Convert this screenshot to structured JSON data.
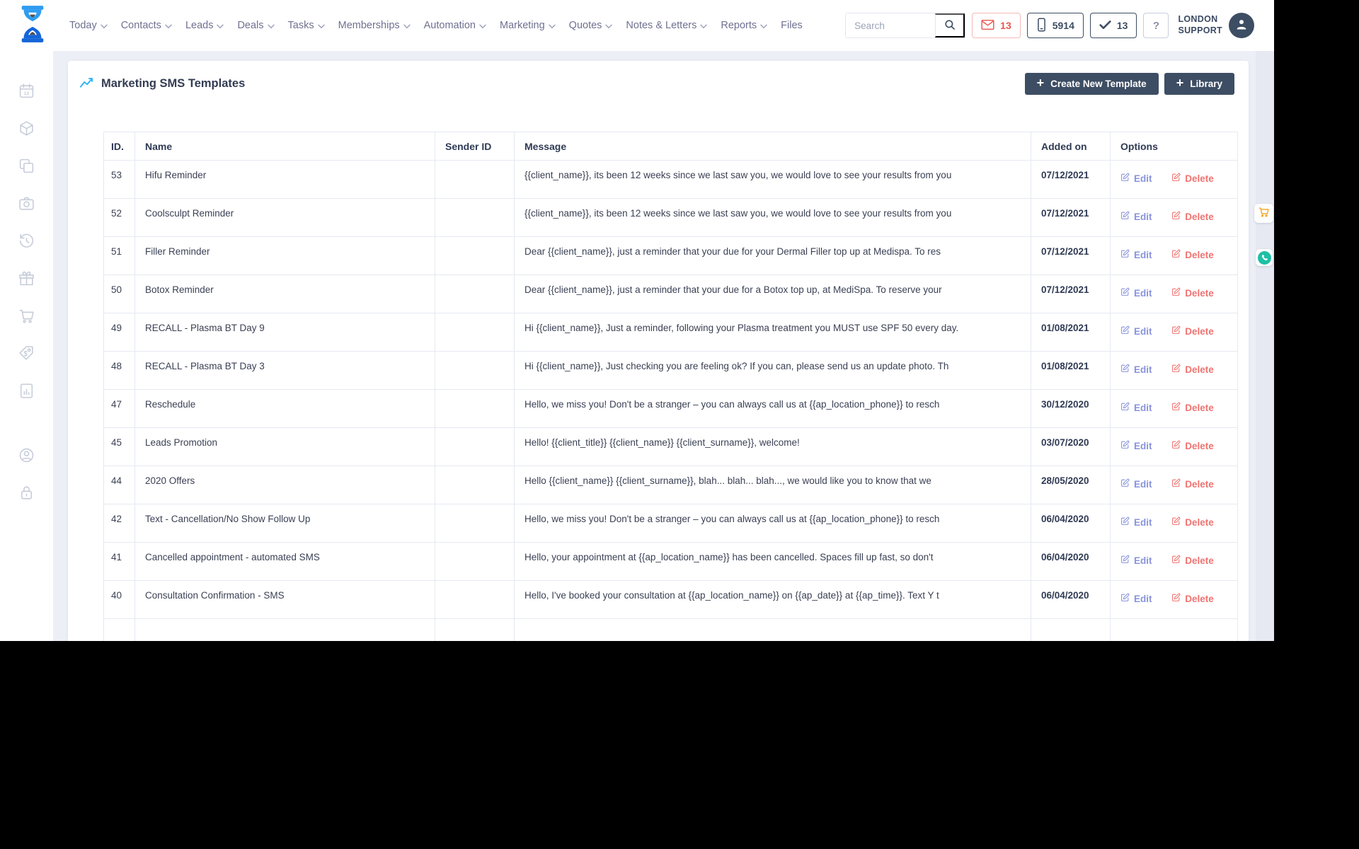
{
  "nav": {
    "items": [
      {
        "label": "Today",
        "dropdown": true
      },
      {
        "label": "Contacts",
        "dropdown": true
      },
      {
        "label": "Leads",
        "dropdown": true
      },
      {
        "label": "Deals",
        "dropdown": true
      },
      {
        "label": "Tasks",
        "dropdown": true
      },
      {
        "label": "Memberships",
        "dropdown": true
      },
      {
        "label": "Automation",
        "dropdown": true
      },
      {
        "label": "Marketing",
        "dropdown": true
      },
      {
        "label": "Quotes",
        "dropdown": true
      },
      {
        "label": "Notes & Letters",
        "dropdown": true
      },
      {
        "label": "Reports",
        "dropdown": true
      },
      {
        "label": "Files",
        "dropdown": false
      }
    ],
    "search_placeholder": "Search",
    "badges": {
      "mail_count": "13",
      "sms_count": "5914",
      "tasks_count": "13"
    },
    "help_label": "?",
    "account_line1": "LONDON",
    "account_line2": "SUPPORT"
  },
  "sidebar": {
    "icons": [
      "calendar",
      "package",
      "copy",
      "camera",
      "history",
      "gift",
      "cart",
      "price-tag",
      "report",
      "account",
      "lock"
    ]
  },
  "page": {
    "title": "Marketing SMS Templates",
    "plus": "+",
    "create_button": "Create New Template",
    "library_button": "Library"
  },
  "table": {
    "columns": [
      "ID.",
      "Name",
      "Sender ID",
      "Message",
      "Added on",
      "Options"
    ],
    "edit_label": "Edit",
    "delete_label": "Delete",
    "rows": [
      {
        "id": "53",
        "name": "Hifu Reminder",
        "sender_id": "",
        "message": "{{client_name}}, its been 12 weeks since we last saw you, we would love to see your results from you",
        "added_on": "07/12/2021"
      },
      {
        "id": "52",
        "name": "Coolsculpt Reminder",
        "sender_id": "",
        "message": "{{client_name}}, its been 12 weeks since we last saw you, we would love to see your results from you",
        "added_on": "07/12/2021"
      },
      {
        "id": "51",
        "name": "Filler Reminder",
        "sender_id": "",
        "message": "Dear {{client_name}}, just a reminder that your due for your Dermal Filler top up at Medispa. To res",
        "added_on": "07/12/2021"
      },
      {
        "id": "50",
        "name": "Botox Reminder",
        "sender_id": "",
        "message": "Dear {{client_name}}, just a reminder that your due for a Botox top up, at MediSpa. To reserve your",
        "added_on": "07/12/2021"
      },
      {
        "id": "49",
        "name": "RECALL - Plasma BT Day 9",
        "sender_id": "",
        "message": "Hi {{client_name}}, Just a reminder, following your Plasma treatment you MUST use SPF 50 every day.",
        "added_on": "01/08/2021"
      },
      {
        "id": "48",
        "name": "RECALL - Plasma BT Day 3",
        "sender_id": "",
        "message": "Hi {{client_name}}, Just checking you are feeling ok? If you can, please send us an update photo. Th",
        "added_on": "01/08/2021"
      },
      {
        "id": "47",
        "name": "Reschedule",
        "sender_id": "",
        "message": "Hello, we miss you! Don't be a stranger – you can always call us at {{ap_location_phone}} to resch",
        "added_on": "30/12/2020"
      },
      {
        "id": "45",
        "name": "Leads Promotion",
        "sender_id": "",
        "message": "Hello! {{client_title}} {{client_name}} {{client_surname}}, welcome!",
        "added_on": "03/07/2020"
      },
      {
        "id": "44",
        "name": "2020 Offers",
        "sender_id": "",
        "message": "Hello {{client_name}} {{client_surname}}, blah... blah... blah..., we would like you to know that we",
        "added_on": "28/05/2020"
      },
      {
        "id": "42",
        "name": "Text - Cancellation/No Show Follow Up",
        "sender_id": "",
        "message": "Hello, we miss you! Don't be a stranger – you can always call us at {{ap_location_phone}} to resch",
        "added_on": "06/04/2020"
      },
      {
        "id": "41",
        "name": "Cancelled appointment - automated SMS",
        "sender_id": "",
        "message": "Hello, your appointment at {{ap_location_name}} has been cancelled. Spaces fill up fast, so don't",
        "added_on": "06/04/2020"
      },
      {
        "id": "40",
        "name": "Consultation Confirmation - SMS",
        "sender_id": "",
        "message": "Hello, I've booked your consultation at {{ap_location_name}} on {{ap_date}} at {{ap_time}}. Text Y t",
        "added_on": "06/04/2020"
      }
    ]
  },
  "colors": {
    "logo_blue_light": "#2d9cf0",
    "logo_blue_dark": "#1565d8",
    "accent_dark": "#3d4d63",
    "title_chart_blue": "#35b7f4",
    "edit_link": "#8893dd",
    "delete_link": "#ef7370",
    "mail_badge": "#e8554f",
    "cart_orange": "#f5a31d",
    "whatsapp_teal": "#1ec0a6",
    "content_bg": "#edeff6"
  }
}
